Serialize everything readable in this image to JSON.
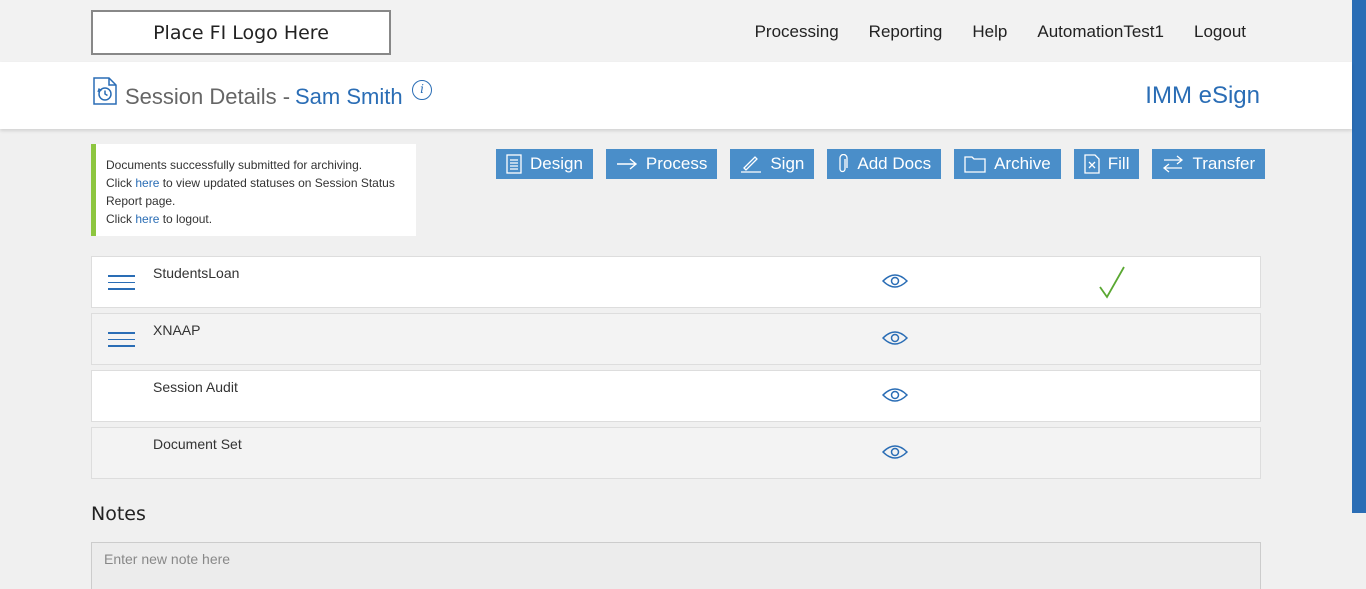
{
  "header": {
    "logo_text": "Place FI Logo Here",
    "nav": [
      "Processing",
      "Reporting",
      "Help",
      "AutomationTest1",
      "Logout"
    ]
  },
  "subheader": {
    "title": "Session Details -",
    "name": "Sam Smith",
    "info_glyph": "i",
    "brand": "IMM eSign"
  },
  "alert": {
    "line1": "Documents successfully submitted for archiving.",
    "line2_pre": "Click ",
    "link1": "here",
    "line2_post": " to view updated statuses on Session Status Report page.",
    "line3_pre": "Click ",
    "link2": "here",
    "line3_post": " to logout."
  },
  "actions": [
    {
      "label": "Design",
      "icon": "document-list-icon"
    },
    {
      "label": "Process",
      "icon": "arrow-right-icon"
    },
    {
      "label": "Sign",
      "icon": "pen-icon"
    },
    {
      "label": "Add Docs",
      "icon": "paperclip-icon"
    },
    {
      "label": "Archive",
      "icon": "folder-icon"
    },
    {
      "label": "Fill",
      "icon": "doc-x-icon"
    },
    {
      "label": "Transfer",
      "icon": "transfer-arrows-icon"
    }
  ],
  "documents": [
    {
      "name": "StudentsLoan",
      "has_menu": true,
      "checked": true
    },
    {
      "name": "XNAAP",
      "has_menu": true,
      "checked": false
    },
    {
      "name": "Session Audit",
      "has_menu": false,
      "checked": false
    },
    {
      "name": "Document Set",
      "has_menu": false,
      "checked": false
    }
  ],
  "notes": {
    "title": "Notes",
    "placeholder": "Enter new note here"
  },
  "colors": {
    "accent": "#2a6db5",
    "button": "#4a8ec9",
    "success": "#8dc63f",
    "check": "#5aa832"
  }
}
